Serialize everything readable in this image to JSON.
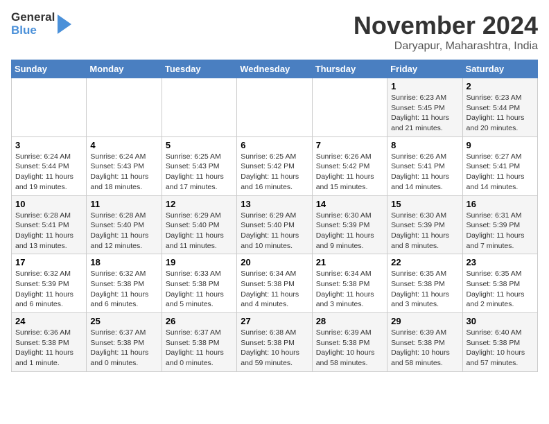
{
  "header": {
    "logo_line1": "General",
    "logo_line2": "Blue",
    "title": "November 2024",
    "location": "Daryapur, Maharashtra, India"
  },
  "days_header": [
    "Sunday",
    "Monday",
    "Tuesday",
    "Wednesday",
    "Thursday",
    "Friday",
    "Saturday"
  ],
  "weeks": [
    [
      {
        "day": "",
        "info": ""
      },
      {
        "day": "",
        "info": ""
      },
      {
        "day": "",
        "info": ""
      },
      {
        "day": "",
        "info": ""
      },
      {
        "day": "",
        "info": ""
      },
      {
        "day": "1",
        "info": "Sunrise: 6:23 AM\nSunset: 5:45 PM\nDaylight: 11 hours and 21 minutes."
      },
      {
        "day": "2",
        "info": "Sunrise: 6:23 AM\nSunset: 5:44 PM\nDaylight: 11 hours and 20 minutes."
      }
    ],
    [
      {
        "day": "3",
        "info": "Sunrise: 6:24 AM\nSunset: 5:44 PM\nDaylight: 11 hours and 19 minutes."
      },
      {
        "day": "4",
        "info": "Sunrise: 6:24 AM\nSunset: 5:43 PM\nDaylight: 11 hours and 18 minutes."
      },
      {
        "day": "5",
        "info": "Sunrise: 6:25 AM\nSunset: 5:43 PM\nDaylight: 11 hours and 17 minutes."
      },
      {
        "day": "6",
        "info": "Sunrise: 6:25 AM\nSunset: 5:42 PM\nDaylight: 11 hours and 16 minutes."
      },
      {
        "day": "7",
        "info": "Sunrise: 6:26 AM\nSunset: 5:42 PM\nDaylight: 11 hours and 15 minutes."
      },
      {
        "day": "8",
        "info": "Sunrise: 6:26 AM\nSunset: 5:41 PM\nDaylight: 11 hours and 14 minutes."
      },
      {
        "day": "9",
        "info": "Sunrise: 6:27 AM\nSunset: 5:41 PM\nDaylight: 11 hours and 14 minutes."
      }
    ],
    [
      {
        "day": "10",
        "info": "Sunrise: 6:28 AM\nSunset: 5:41 PM\nDaylight: 11 hours and 13 minutes."
      },
      {
        "day": "11",
        "info": "Sunrise: 6:28 AM\nSunset: 5:40 PM\nDaylight: 11 hours and 12 minutes."
      },
      {
        "day": "12",
        "info": "Sunrise: 6:29 AM\nSunset: 5:40 PM\nDaylight: 11 hours and 11 minutes."
      },
      {
        "day": "13",
        "info": "Sunrise: 6:29 AM\nSunset: 5:40 PM\nDaylight: 11 hours and 10 minutes."
      },
      {
        "day": "14",
        "info": "Sunrise: 6:30 AM\nSunset: 5:39 PM\nDaylight: 11 hours and 9 minutes."
      },
      {
        "day": "15",
        "info": "Sunrise: 6:30 AM\nSunset: 5:39 PM\nDaylight: 11 hours and 8 minutes."
      },
      {
        "day": "16",
        "info": "Sunrise: 6:31 AM\nSunset: 5:39 PM\nDaylight: 11 hours and 7 minutes."
      }
    ],
    [
      {
        "day": "17",
        "info": "Sunrise: 6:32 AM\nSunset: 5:39 PM\nDaylight: 11 hours and 6 minutes."
      },
      {
        "day": "18",
        "info": "Sunrise: 6:32 AM\nSunset: 5:38 PM\nDaylight: 11 hours and 6 minutes."
      },
      {
        "day": "19",
        "info": "Sunrise: 6:33 AM\nSunset: 5:38 PM\nDaylight: 11 hours and 5 minutes."
      },
      {
        "day": "20",
        "info": "Sunrise: 6:34 AM\nSunset: 5:38 PM\nDaylight: 11 hours and 4 minutes."
      },
      {
        "day": "21",
        "info": "Sunrise: 6:34 AM\nSunset: 5:38 PM\nDaylight: 11 hours and 3 minutes."
      },
      {
        "day": "22",
        "info": "Sunrise: 6:35 AM\nSunset: 5:38 PM\nDaylight: 11 hours and 3 minutes."
      },
      {
        "day": "23",
        "info": "Sunrise: 6:35 AM\nSunset: 5:38 PM\nDaylight: 11 hours and 2 minutes."
      }
    ],
    [
      {
        "day": "24",
        "info": "Sunrise: 6:36 AM\nSunset: 5:38 PM\nDaylight: 11 hours and 1 minute."
      },
      {
        "day": "25",
        "info": "Sunrise: 6:37 AM\nSunset: 5:38 PM\nDaylight: 11 hours and 0 minutes."
      },
      {
        "day": "26",
        "info": "Sunrise: 6:37 AM\nSunset: 5:38 PM\nDaylight: 11 hours and 0 minutes."
      },
      {
        "day": "27",
        "info": "Sunrise: 6:38 AM\nSunset: 5:38 PM\nDaylight: 10 hours and 59 minutes."
      },
      {
        "day": "28",
        "info": "Sunrise: 6:39 AM\nSunset: 5:38 PM\nDaylight: 10 hours and 58 minutes."
      },
      {
        "day": "29",
        "info": "Sunrise: 6:39 AM\nSunset: 5:38 PM\nDaylight: 10 hours and 58 minutes."
      },
      {
        "day": "30",
        "info": "Sunrise: 6:40 AM\nSunset: 5:38 PM\nDaylight: 10 hours and 57 minutes."
      }
    ]
  ]
}
